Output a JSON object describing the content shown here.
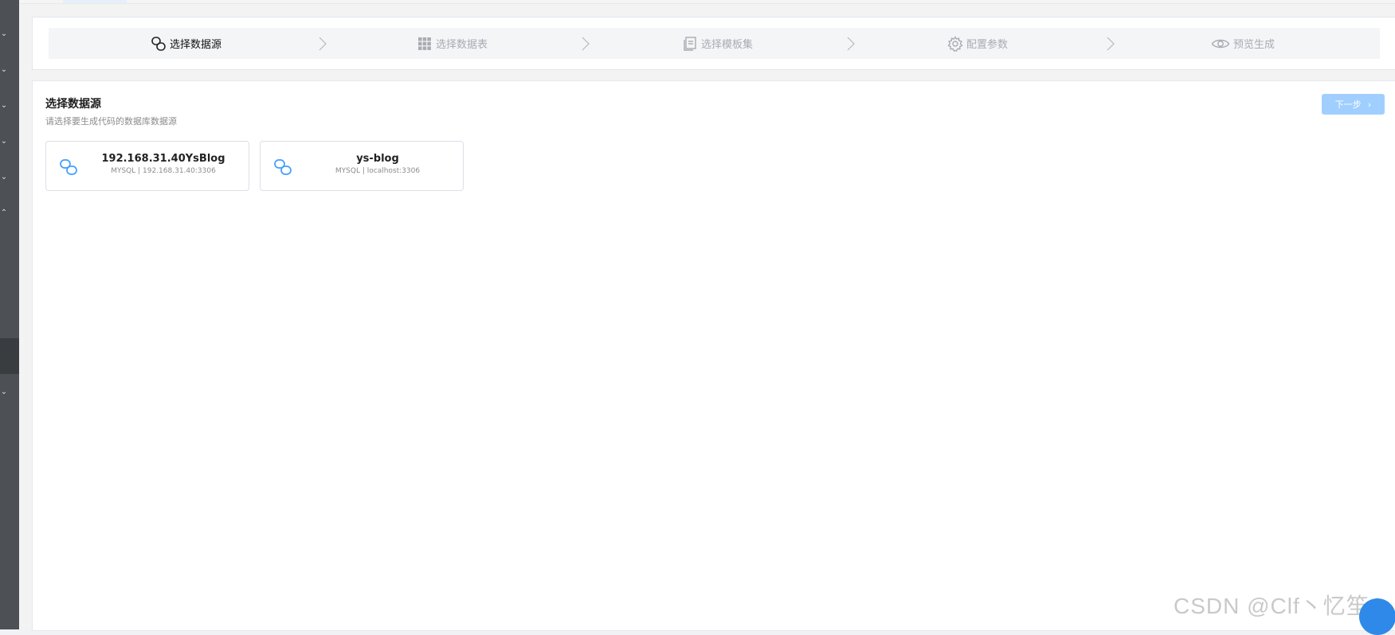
{
  "steps": [
    {
      "label": "选择数据源",
      "icon": "link-icon",
      "active": true
    },
    {
      "label": "选择数据表",
      "icon": "grid-icon",
      "active": false
    },
    {
      "label": "选择模板集",
      "icon": "document-icon",
      "active": false
    },
    {
      "label": "配置参数",
      "icon": "gear-icon",
      "active": false
    },
    {
      "label": "预览生成",
      "icon": "eye-icon",
      "active": false
    }
  ],
  "section": {
    "title": "选择数据源",
    "subtitle": "请选择要生成代码的数据库数据源",
    "next_label": "下一步"
  },
  "datasources": [
    {
      "name": "192.168.31.40YsBlog",
      "meta": "MYSQL | 192.168.31.40:3306"
    },
    {
      "name": "ys-blog",
      "meta": "MYSQL | localhost:3306"
    }
  ],
  "watermark": "CSDN @Clf丶忆笙",
  "colors": {
    "sidebar": "#4d5155",
    "accent": "#409eff",
    "disabled_button": "#a0cfff"
  }
}
